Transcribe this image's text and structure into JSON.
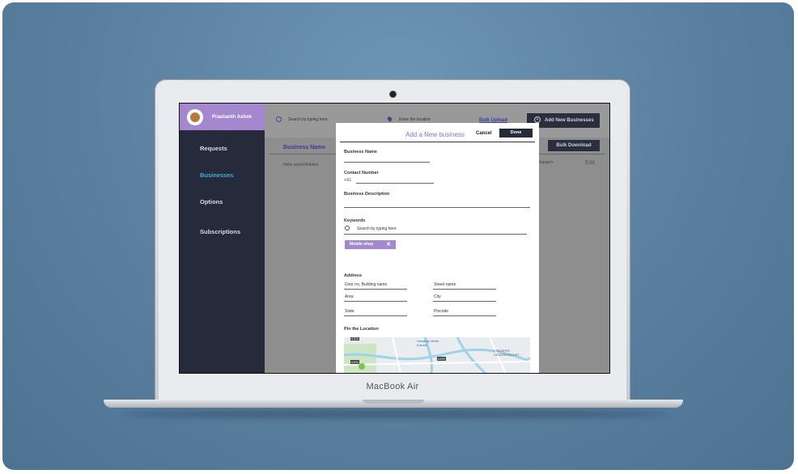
{
  "device": {
    "brand": "MacBook Air"
  },
  "sidebar": {
    "profile_name": "Prashanth Ashok",
    "items": [
      {
        "label": "Requests",
        "active": false
      },
      {
        "label": "Businesses",
        "active": true
      },
      {
        "label": "Options",
        "active": false
      },
      {
        "label": "Subscriptions",
        "active": false
      }
    ]
  },
  "topbar": {
    "search_placeholder": "Search by typing here",
    "location_placeholder": "Enter the location",
    "bulk_upload": "Bulk Upload",
    "add_button": "Add New Businesses",
    "bulk_download": "Bulk Download"
  },
  "table": {
    "column_header": "Business Name",
    "rows": [
      {
        "name": "Hello world Mobiles",
        "extra": "ble chargers",
        "edit": "Edit"
      }
    ]
  },
  "modal": {
    "title": "Add a New business",
    "cancel": "Cancel",
    "done": "Done",
    "business_name_label": "Business Name",
    "contact_label": "Contact Number",
    "country_code": "+91",
    "description_label": "Business Description",
    "keywords_label": "Keywords",
    "keywords_placeholder": "Search by typing here",
    "keyword_chip": "Mobile shop",
    "address_label": "Address",
    "address_fields": {
      "door": "Door no, Building name",
      "street": "Street name",
      "area": "Area",
      "city": "City",
      "state": "State",
      "pincode": "Pincode"
    },
    "pin_label": "Pin the Location",
    "map_labels": [
      "s104",
      "Westelijk Markt Kanaal",
      "s105",
      "FREDERIK HENDRIKBUURT",
      "s103"
    ]
  },
  "colors": {
    "accent_purple": "#a487cf",
    "sidebar_bg": "#262b3b",
    "active_nav": "#3db2d8"
  }
}
